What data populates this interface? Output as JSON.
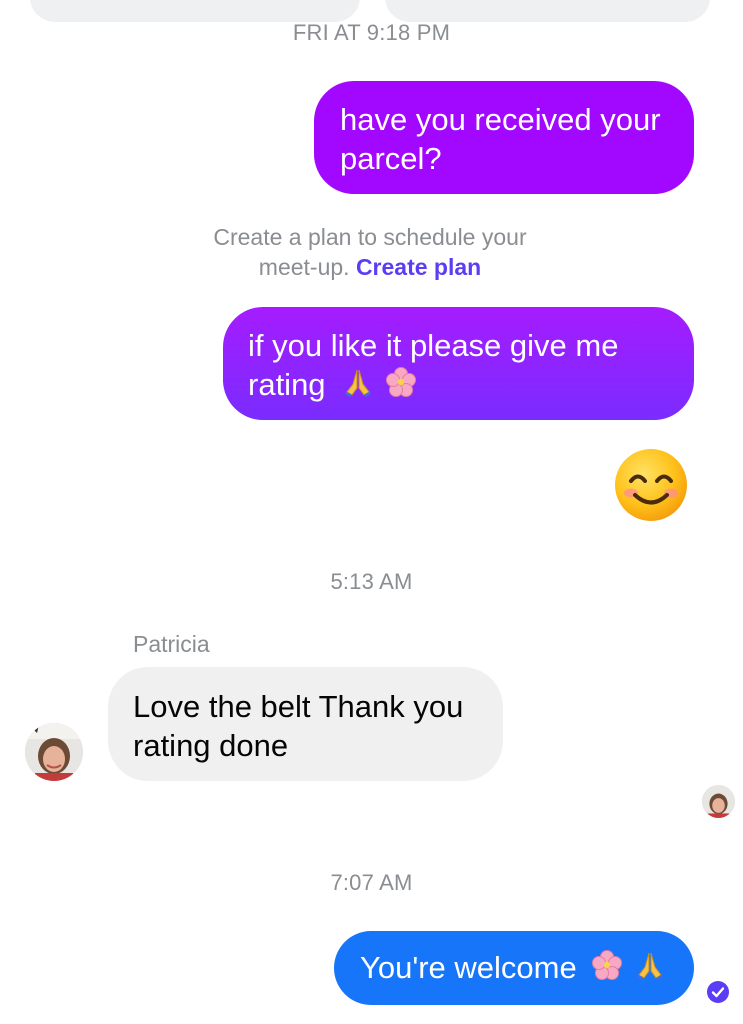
{
  "timestamps": {
    "first": "FRI AT 9:18 PM",
    "second": "5:13 AM",
    "third": "7:07 AM"
  },
  "messages": {
    "m1": {
      "line1": "have you received your",
      "line2": "parcel?"
    },
    "plan_hint": {
      "line1": "Create a plan to schedule your",
      "line2": "meet-up.",
      "link": "Create plan"
    },
    "m2": {
      "line1": "if you like it please give me",
      "line2": "rating"
    },
    "reply": {
      "sender": "Patricia",
      "line1": "Love the belt Thank you",
      "line2": "rating done"
    },
    "m3": {
      "text": "You're welcome"
    }
  },
  "icons": {
    "praying": "folded-hands-icon",
    "flower": "cherry-blossom-icon",
    "smile": "smiling-face-icon",
    "seen": "delivered-check-icon"
  },
  "colors": {
    "outgoing_purple": "#a208ff",
    "outgoing_blue": "#1675f8",
    "incoming_gray": "#f0f0f0",
    "link": "#5b3df5",
    "meta_text": "#8a8d91"
  }
}
